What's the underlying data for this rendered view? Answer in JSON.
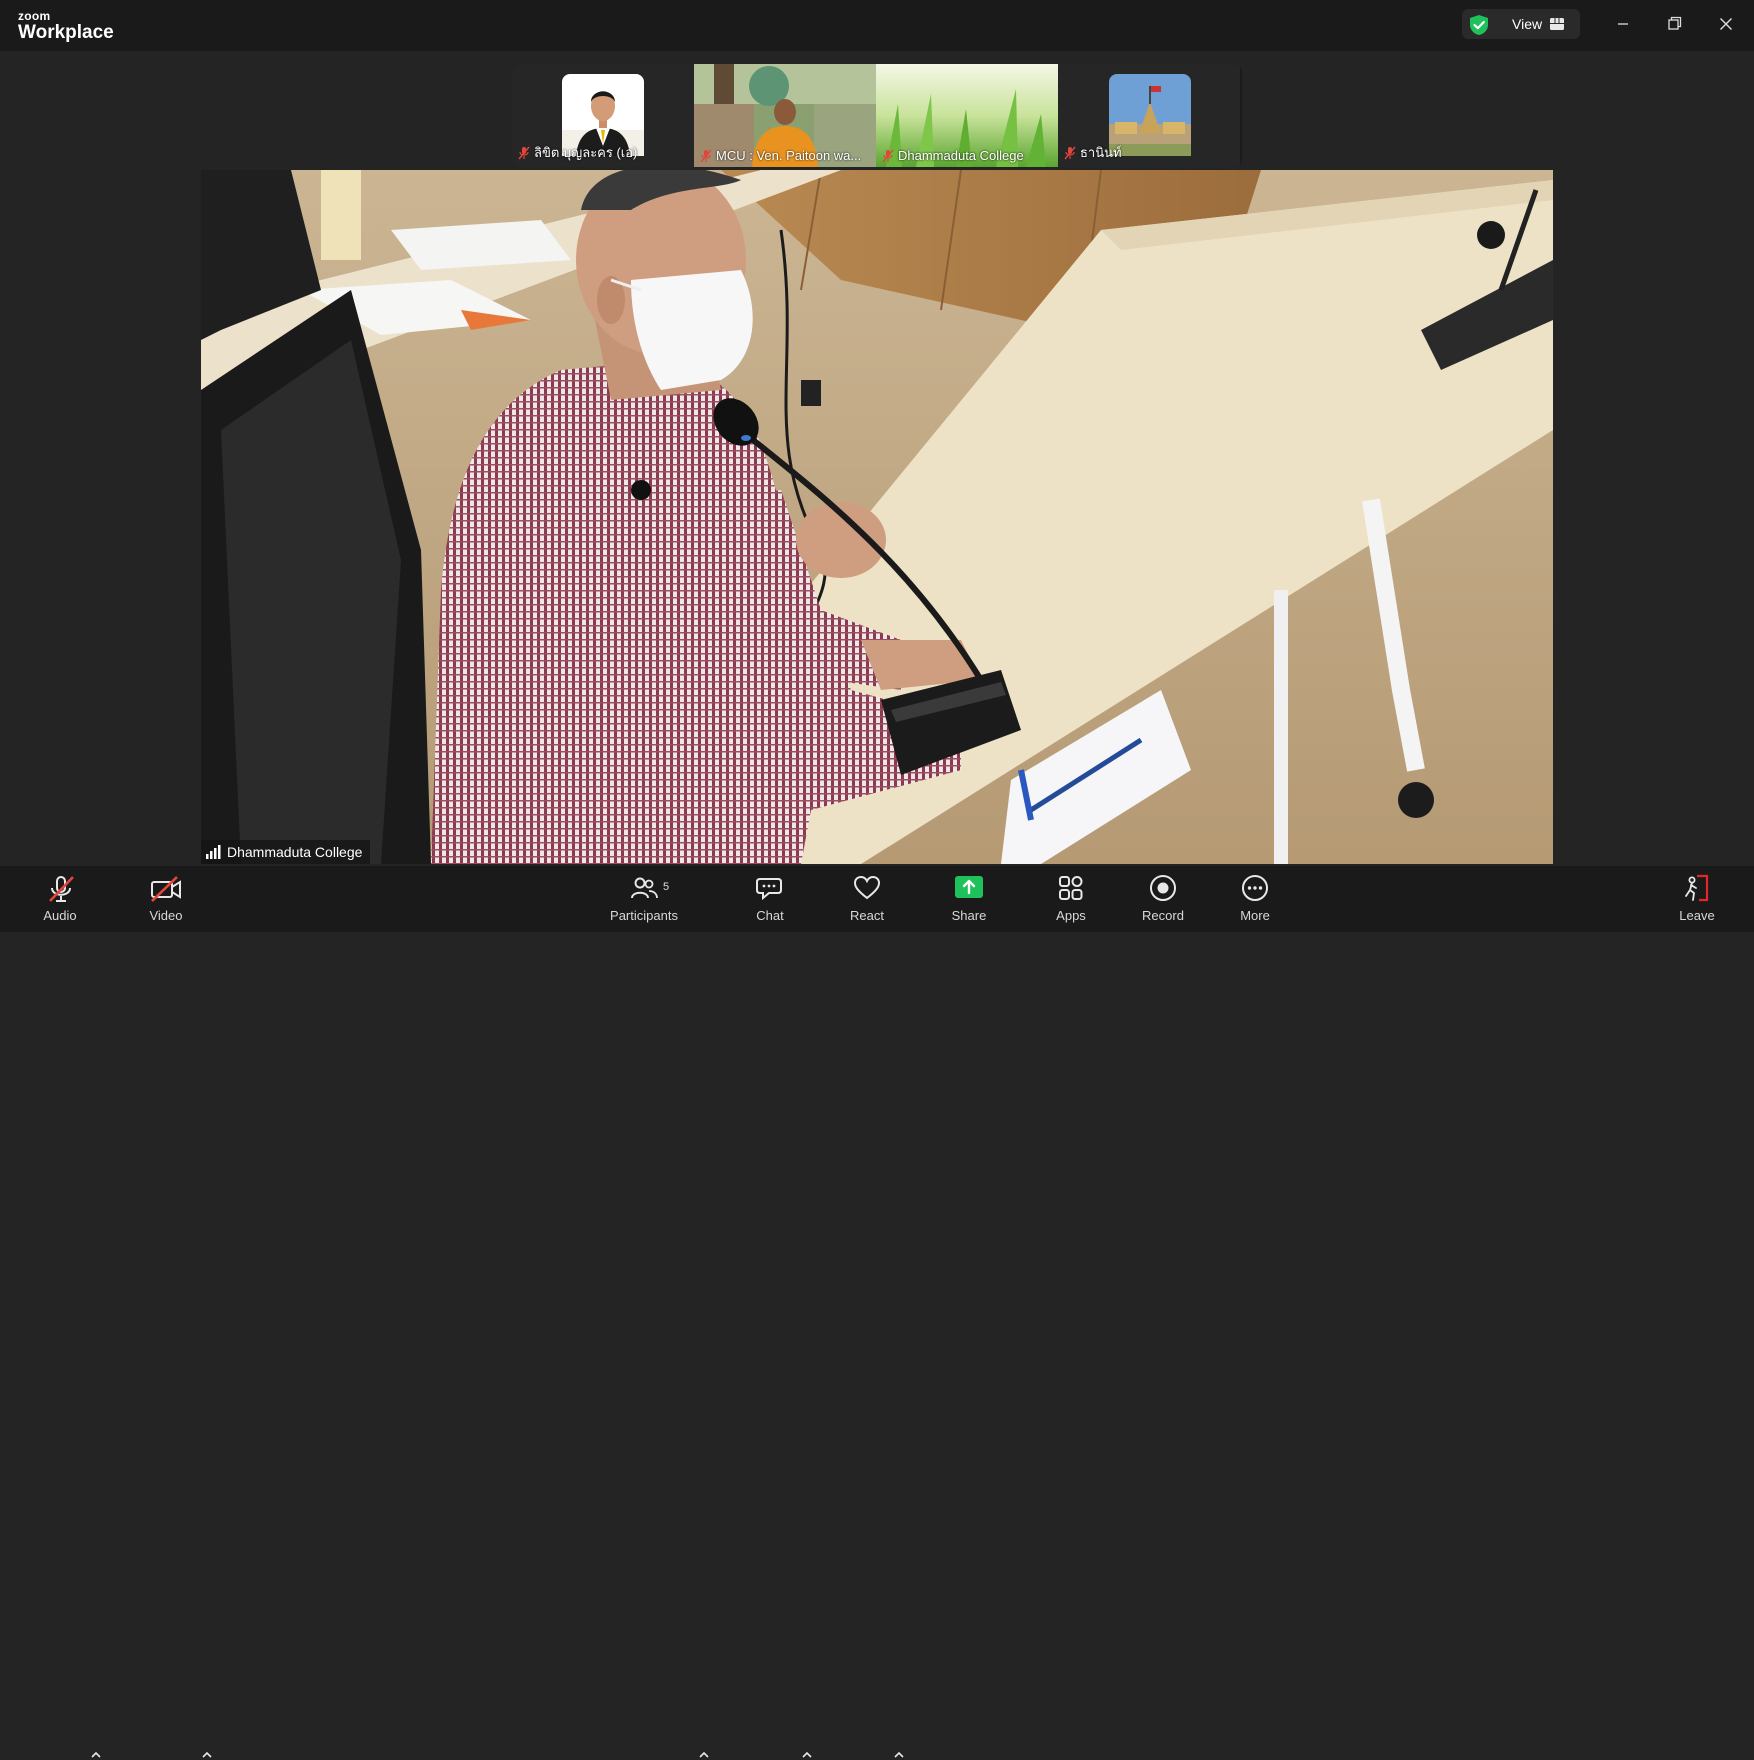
{
  "app": {
    "brand_small": "zoom",
    "brand_big": "Workplace"
  },
  "titlebar": {
    "view_label": "View"
  },
  "gallery": [
    {
      "name": "ลิขิต บุญละคร (เอ)"
    },
    {
      "name": "MCU : Ven. Paitoon wa..."
    },
    {
      "name": "Dhammaduta College"
    },
    {
      "name": "ธานินท์"
    }
  ],
  "main": {
    "speaker_name": "Dhammaduta College"
  },
  "toolbar": {
    "audio": "Audio",
    "video": "Video",
    "participants": "Participants",
    "participants_count": "5",
    "chat": "Chat",
    "react": "React",
    "share": "Share",
    "apps": "Apps",
    "record": "Record",
    "more": "More",
    "leave": "Leave"
  },
  "colors": {
    "accent_green": "#1fc15a",
    "mute_red": "#e2453c",
    "leave_red": "#e02828"
  }
}
